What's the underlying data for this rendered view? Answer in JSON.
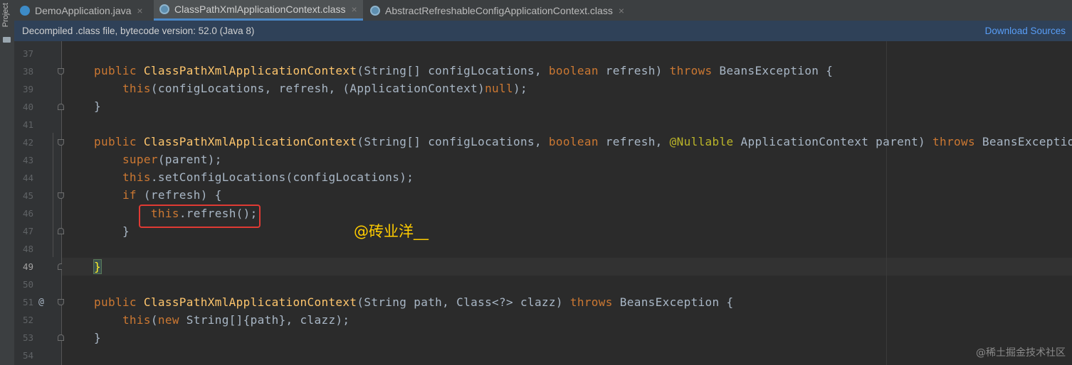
{
  "sidebar": {
    "label": "Project"
  },
  "tabs": [
    {
      "label": "DemoApplication.java",
      "close": "×"
    },
    {
      "label": "ClassPathXmlApplicationContext.class",
      "close": "×"
    },
    {
      "label": "AbstractRefreshableConfigApplicationContext.class",
      "close": "×"
    }
  ],
  "infobar": {
    "message": "Decompiled .class file, bytecode version: 52.0 (Java 8)",
    "action": "Download Sources"
  },
  "gutter": {
    "line_numbers": [
      "37",
      "38",
      "39",
      "40",
      "41",
      "42",
      "43",
      "44",
      "45",
      "46",
      "47",
      "48",
      "49",
      "50",
      "51",
      "52",
      "53",
      "54"
    ],
    "current_line": "49",
    "override_marker": "@"
  },
  "code": {
    "line38": {
      "kw1": "public",
      "fn": "ClassPathXmlApplicationContext",
      "p1": "(String[] configLocations, ",
      "kw2": "boolean",
      "p2": " refresh) ",
      "kw3": "throws",
      "p3": " BeansException {"
    },
    "line39": {
      "kw1": "this",
      "p1": "(configLocations, refresh, (ApplicationContext)",
      "kw2": "null",
      "p2": ");"
    },
    "line40": "}",
    "line42": {
      "kw1": "public",
      "fn": "ClassPathXmlApplicationContext",
      "p1": "(String[] configLocations, ",
      "kw2": "boolean",
      "p2": " refresh, ",
      "an": "@Nullable",
      "p3": " ApplicationContext parent) ",
      "kw3": "throws",
      "p4": " BeansException ",
      "brace": "{"
    },
    "line43": {
      "kw1": "super",
      "p1": "(parent);"
    },
    "line44": {
      "kw1": "this",
      "p1": ".setConfigLocations(configLocations);"
    },
    "line45": {
      "kw1": "if",
      "p1": " (refresh) {"
    },
    "line46": {
      "kw1": "this",
      "p1": ".refresh();"
    },
    "line47": "}",
    "line49": "}",
    "line51": {
      "kw1": "public",
      "fn": "ClassPathXmlApplicationContext",
      "p1": "(String path, Class<?> clazz) ",
      "kw2": "throws",
      "p2": " BeansException {"
    },
    "line52": {
      "kw1": "this",
      "p1": "(",
      "kw2": "new",
      "p2": " String[]{path}, clazz);"
    },
    "line53": "}"
  },
  "watermarks": {
    "author": "@砖业洋__",
    "site": "@稀土掘金技术社区"
  }
}
